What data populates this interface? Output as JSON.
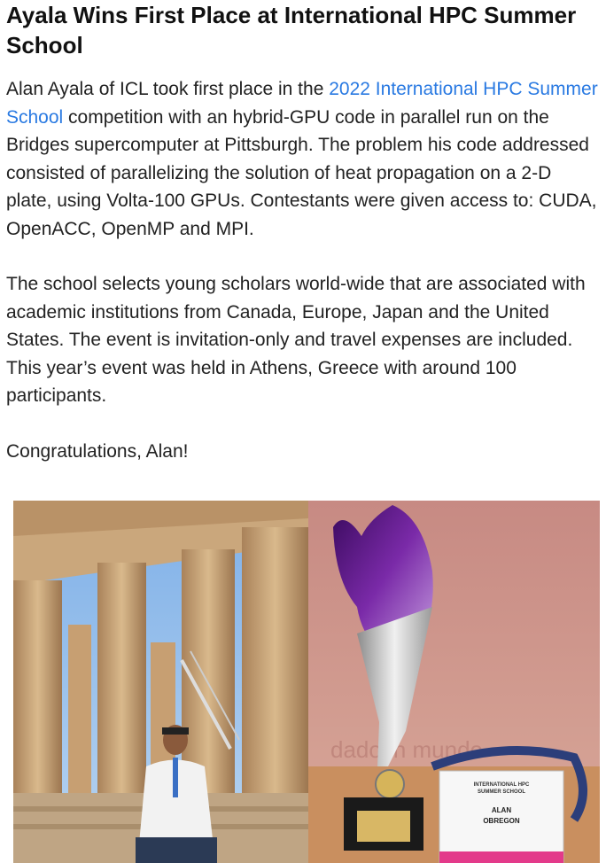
{
  "article": {
    "title": "Ayala Wins First Place at International HPC Summer School",
    "p1_before": "Alan Ayala of ICL took first place in the ",
    "p1_link": "2022 International HPC Summer School",
    "p1_after": " competition with an hybrid-GPU code in parallel run on the Bridges supercomputer at Pittsburgh. The problem his code addressed consisted of parallelizing the solution of heat propagation on a 2-D plate, using Volta-100 GPUs. Contestants were given access to: CUDA, OpenACC, OpenMP and MPI.",
    "p2": "The school selects young scholars world-wide that are associated with academic institutions from Canada, Europe, Japan and the United States. The event is invitation-only and travel expenses are included. This year’s event was held in Athens, Greece with around 100 participants.",
    "p3": "Congratulations, Alan!"
  },
  "photos": {
    "badge_title_line1": "INTERNATIONAL HPC",
    "badge_title_line2": "SUMMER SCHOOL",
    "badge_name_line1": "ALAN",
    "badge_name_line2": "OBREGON",
    "wall_text": "dado in mundo"
  },
  "colors": {
    "link": "#2a7ae2",
    "sky": "#8fb8e6",
    "marble": "#c9a57a",
    "wall": "#c98a80",
    "trophy_purple": "#6a1b9a"
  }
}
